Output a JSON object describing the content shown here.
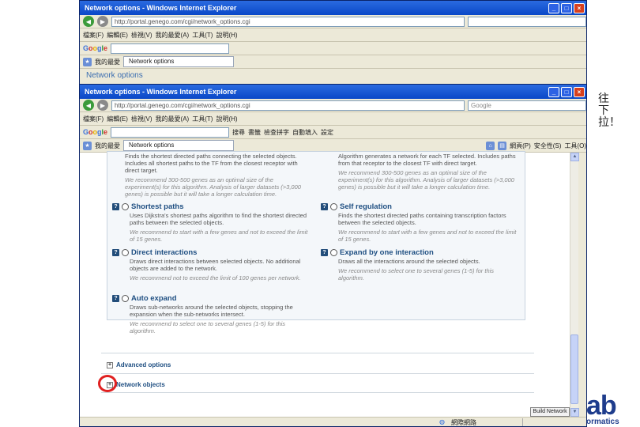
{
  "back_window": {
    "title": "Network options - Windows Internet Explorer",
    "url": "http://portal.genego.com/cgi/network_options.cgi",
    "menu": [
      "檔案(F)",
      "編輯(E)",
      "檢視(V)",
      "我的最愛(A)",
      "工具(T)",
      "說明(H)"
    ],
    "tab_label": "Network options",
    "favorites_label": "我的最愛",
    "page_heading": "Network options"
  },
  "front_window": {
    "title": "Network options - Windows Internet Explorer",
    "url": "http://portal.genego.com/cgi/network_options.cgi",
    "search_placeholder": "Google",
    "menu": [
      "檔案(F)",
      "編輯(E)",
      "檢視(V)",
      "我的最愛(A)",
      "工具(T)",
      "說明(H)"
    ],
    "google_label": "Google",
    "toolbar": [
      "搜尋",
      "書籤",
      "檢查拼字",
      "自動填入",
      "設定"
    ],
    "favorites_label": "我的最愛",
    "tab_label": "Network options",
    "right_tools": [
      "網頁(P)",
      "安全性(S)",
      "工具(O)"
    ]
  },
  "options": {
    "top_left_desc": "Finds the shortest directed paths connecting the selected objects. Includes all shortest paths to the TF from the closest receptor with direct target.",
    "top_left_rec": "We recommend 300-500 genes as an optimal size of the experiment(s) for this algorithm. Analysis of larger datasets (>3,000 genes) is possible but it will take a longer calculation time.",
    "top_right_desc": "Algorithm generates a network for each TF selected. Includes paths from that receptor to the closest TF with direct target.",
    "top_right_rec": "We recommend 300-500 genes as an optimal size of the experiment(s) for this algorithm. Analysis of larger datasets (>3,000 genes) is possible but it will take a longer calculation time.",
    "items": [
      {
        "title": "Shortest paths",
        "desc": "Uses Dijkstra's shortest paths algorithm to find the shortest directed paths between the selected objects.",
        "rec": "We recommend to start with a few genes and not to exceed the limit of 15 genes."
      },
      {
        "title": "Self regulation",
        "desc": "Finds the shortest directed paths containing transcription factors between the selected objects.",
        "rec": "We recommend to start with a few genes and not to exceed the limit of 15 genes."
      },
      {
        "title": "Direct interactions",
        "desc": "Draws direct interactions between selected objects. No additional objects are added to the network.",
        "rec": "We recommend not to exceed the limit of 100 genes per network."
      },
      {
        "title": "Expand by one interaction",
        "desc": "Draws all the interactions around the selected objects.",
        "rec": "We recommend to select one to several genes (1-5) for this algorithm."
      },
      {
        "title": "Auto expand",
        "desc": "Draws sub-networks around the selected objects, stopping the expansion when the sub-networks intersect.",
        "rec": "We recommend to select one to several genes (1-5) for this algorithm."
      }
    ]
  },
  "sections": {
    "advanced": "Advanced options",
    "network_objects": "Network objects"
  },
  "buttons": {
    "build_network": "Build Network"
  },
  "status": {
    "zone": "網際網路"
  },
  "side_text": "往下拉！",
  "logo": {
    "big": "ab",
    "sub": "ormatics"
  },
  "colors": {
    "title_blue": "#1f4f82",
    "highlight_circle": "#e02020"
  }
}
